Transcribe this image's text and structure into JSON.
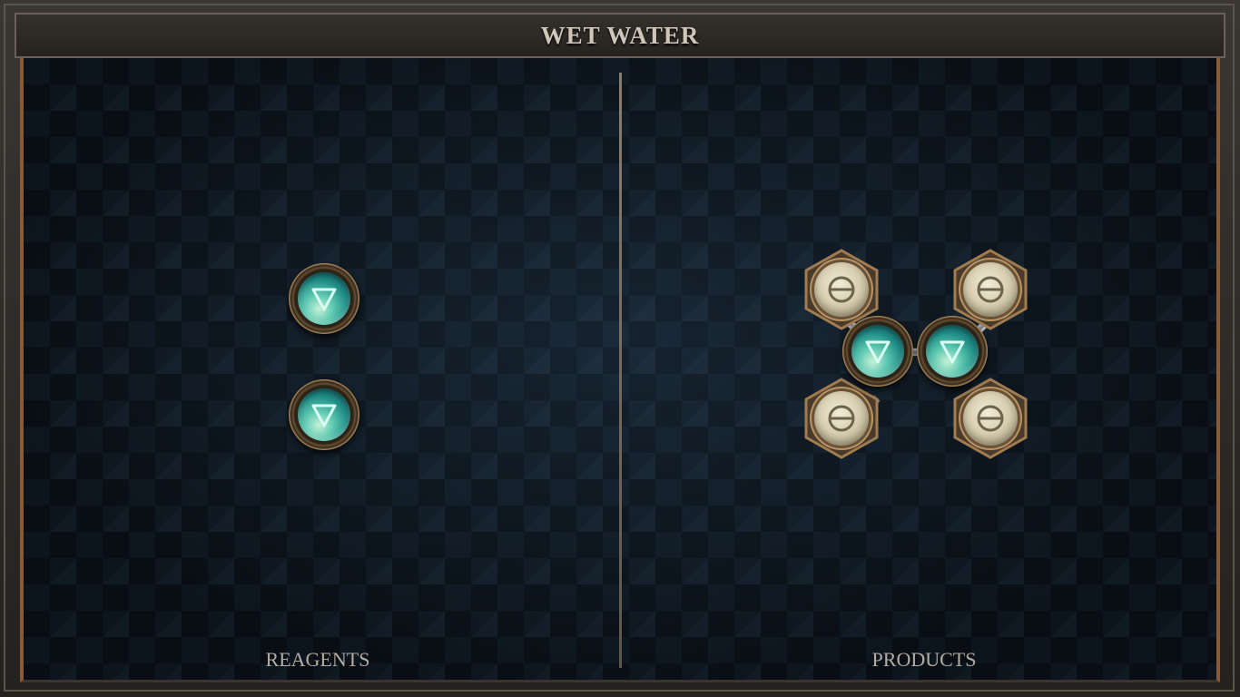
{
  "title": "WET WATER",
  "panels": {
    "left_label": "REAGENTS",
    "right_label": "PRODUCTS"
  },
  "reagents": [
    {
      "element": "water",
      "icon": "water-triangle-icon"
    },
    {
      "element": "water",
      "icon": "water-triangle-icon"
    }
  ],
  "product": {
    "atoms": [
      {
        "element": "salt",
        "icon": "salt-circle-icon"
      },
      {
        "element": "salt",
        "icon": "salt-circle-icon"
      },
      {
        "element": "water",
        "icon": "water-triangle-icon"
      },
      {
        "element": "water",
        "icon": "water-triangle-icon"
      },
      {
        "element": "salt",
        "icon": "salt-circle-icon"
      },
      {
        "element": "salt",
        "icon": "salt-circle-icon"
      }
    ],
    "bond_count": 5
  },
  "colors": {
    "water_orb": "#2a9e94",
    "salt_pearl": "#ddd4b8",
    "frame_accent": "#8a5a34",
    "label_text": "#b3aca3"
  }
}
